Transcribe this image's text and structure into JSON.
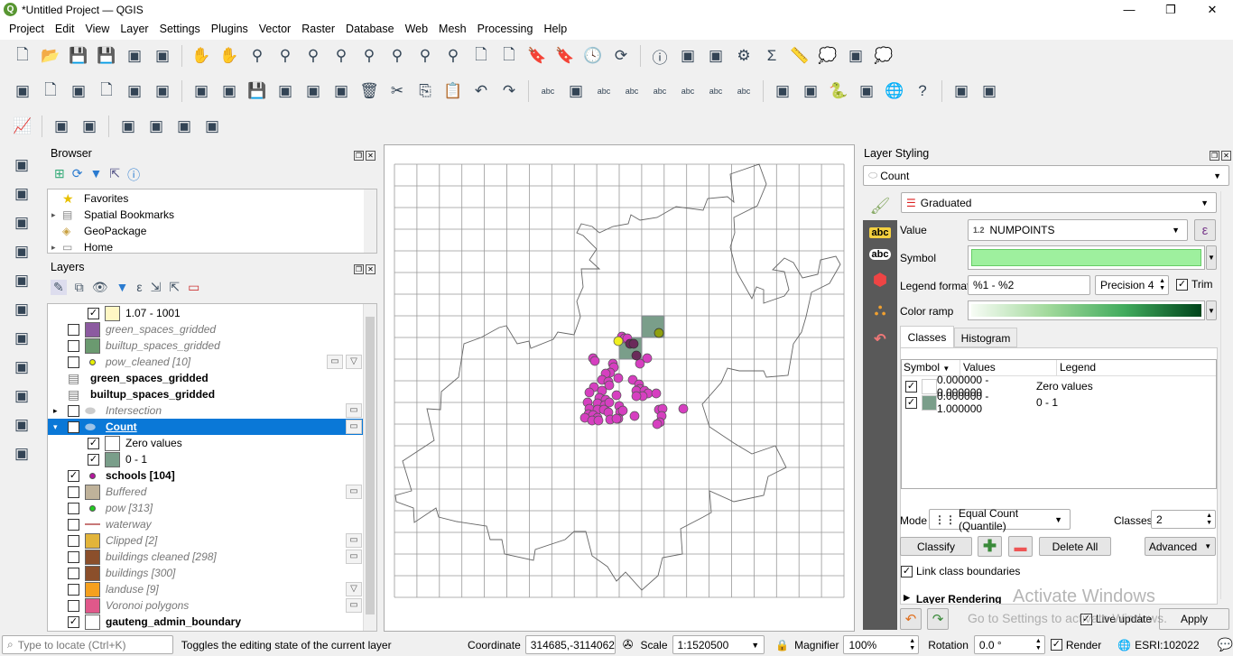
{
  "window": {
    "title": "*Untitled Project — QGIS",
    "minimize": "—",
    "maximize": "❐",
    "close": "✕"
  },
  "menu": [
    "Project",
    "Edit",
    "View",
    "Layer",
    "Settings",
    "Plugins",
    "Vector",
    "Raster",
    "Database",
    "Web",
    "Mesh",
    "Processing",
    "Help"
  ],
  "toolbar1": [
    "new-project-icon",
    "open-project-icon",
    "save-project-icon",
    "save-as-icon",
    "print-layout-icon",
    "layout-manager-icon",
    "sep",
    "pan-icon",
    "pan-to-selection-icon",
    "zoom-in-icon",
    "zoom-out-icon",
    "zoom-full-icon",
    "zoom-to-selection-icon",
    "zoom-to-layer-icon",
    "zoom-native-icon",
    "zoom-last-icon",
    "zoom-next-icon",
    "new-map-view-icon",
    "new-3d-view-icon",
    "bookmark-icon",
    "show-bookmarks-icon",
    "temporal-icon",
    "refresh-icon",
    "sep",
    "identify-icon",
    "attribute-table-icon",
    "field-calculator-icon",
    "toolbox-icon",
    "statistics-icon",
    "measure-icon",
    "annotation-icon",
    "select-by-location-icon",
    "text-annotation-icon"
  ],
  "toolbar2": [
    "data-source-manager-icon",
    "new-geopackage-icon",
    "digitize-icon",
    "new-layer-icon",
    "virtual-layer-icon",
    "georef-icon",
    "sep",
    "edits-icon",
    "toggle-editing-icon",
    "save-edits-icon",
    "add-feature-icon",
    "vertex-tool-icon",
    "modify-attributes-icon",
    "delete-icon",
    "cut-icon",
    "copy-icon",
    "paste-icon",
    "undo-icon",
    "redo-icon",
    "sep",
    "label-icon",
    "diagram-icon",
    "pin-label-icon",
    "highlight-label-icon",
    "move-label-icon",
    "rotate-label-icon",
    "change-label-icon",
    "show-hide-label-icon",
    "sep",
    "metasearch-icon",
    "wms-icon",
    "python-icon",
    "raster-calc-icon",
    "globe-icon",
    "help-icon",
    "sep",
    "geometry-checker-icon",
    "reload-icon"
  ],
  "toolbar3": [
    "profile-icon",
    "sep",
    "locate-icon",
    "digitizing-icon",
    "sep",
    "select-features-icon",
    "select-by-value-icon",
    "deselect-icon",
    "select-location-icon"
  ],
  "lefttoolbar": [
    "add-vector-icon",
    "add-raster-icon",
    "add-mesh-icon",
    "add-delimited-icon",
    "add-spatialite-icon",
    "add-virtual-icon",
    "add-postgis-icon",
    "add-wms-icon",
    "add-wfs-icon",
    "add-wcs-icon",
    "add-arcgis-icon"
  ],
  "browser": {
    "title": "Browser",
    "items": [
      "Favorites",
      "Spatial Bookmarks",
      "GeoPackage",
      "Home"
    ]
  },
  "layers": {
    "title": "Layers",
    "items": [
      {
        "label": "1.07 - 1001",
        "indent": 1,
        "checked": true,
        "sym": "box",
        "color": "#fff7c4",
        "style": "normal"
      },
      {
        "label": "green_spaces_gridded",
        "indent": 0,
        "checked": false,
        "sym": "box",
        "color": "#8c5aa0",
        "style": "gray"
      },
      {
        "label": "builtup_spaces_gridded",
        "indent": 0,
        "checked": false,
        "sym": "box",
        "color": "#6b9a70",
        "style": "gray"
      },
      {
        "label": "pow_cleaned [10]",
        "indent": 0,
        "checked": false,
        "sym": "dot",
        "color": "#e8f000",
        "style": "gray",
        "icons": [
          "memory",
          "filter"
        ]
      },
      {
        "label": "green_spaces_gridded",
        "indent": 0,
        "checked": null,
        "sym": "table",
        "style": "bold"
      },
      {
        "label": "builtup_spaces_gridded",
        "indent": 0,
        "checked": null,
        "sym": "table",
        "style": "bold"
      },
      {
        "label": "Intersection",
        "indent": 0,
        "checked": false,
        "sym": "poly",
        "color": "#ccc",
        "style": "gray",
        "expander": "▸",
        "icons": [
          "memory"
        ]
      },
      {
        "label": "Count",
        "indent": 0,
        "checked": true,
        "sym": "poly",
        "color": "#9cc3e8",
        "style": "selected",
        "expander": "▾",
        "icons": [
          "memory"
        ]
      },
      {
        "label": "Zero values",
        "indent": 1,
        "checked": true,
        "sym": "box",
        "color": "#ffffff",
        "style": "normal"
      },
      {
        "label": "0 - 1",
        "indent": 1,
        "checked": true,
        "sym": "box",
        "color": "#7a9e8a",
        "style": "normal"
      },
      {
        "label": "schools [104]",
        "indent": 0,
        "checked": true,
        "sym": "dot",
        "color": "#b5179e",
        "style": "bold"
      },
      {
        "label": "Buffered",
        "indent": 0,
        "checked": false,
        "sym": "box",
        "color": "#bfb29a",
        "style": "gray",
        "icons": [
          "memory"
        ]
      },
      {
        "label": "pow [313]",
        "indent": 0,
        "checked": false,
        "sym": "dot",
        "color": "#22cc22",
        "style": "gray"
      },
      {
        "label": "waterway",
        "indent": 0,
        "checked": false,
        "sym": "line",
        "color": "#c87878",
        "style": "gray"
      },
      {
        "label": "Clipped [2]",
        "indent": 0,
        "checked": false,
        "sym": "box",
        "color": "#e2b43a",
        "style": "gray",
        "icons": [
          "memory"
        ]
      },
      {
        "label": "buildings cleaned [298]",
        "indent": 0,
        "checked": false,
        "sym": "box",
        "color": "#8b4f2b",
        "style": "gray",
        "icons": [
          "memory"
        ]
      },
      {
        "label": "buildings [300]",
        "indent": 0,
        "checked": false,
        "sym": "box",
        "color": "#8b4f2b",
        "style": "gray"
      },
      {
        "label": "landuse [9]",
        "indent": 0,
        "checked": false,
        "sym": "box",
        "color": "#f5a01e",
        "style": "gray",
        "icons": [
          "filter"
        ]
      },
      {
        "label": "Voronoi polygons",
        "indent": 0,
        "checked": false,
        "sym": "box",
        "color": "#e0588a",
        "style": "gray",
        "icons": [
          "memory"
        ]
      },
      {
        "label": "gauteng_admin_boundary",
        "indent": 0,
        "checked": true,
        "sym": "box",
        "color": "#ffffff",
        "style": "bold"
      }
    ]
  },
  "styling": {
    "title": "Layer Styling",
    "layer": "Count",
    "renderer": "Graduated",
    "value_label": "Value",
    "value_type": "1.2",
    "value": "NUMPOINTS",
    "symbol_label": "Symbol",
    "symbol_color": "#9ef09e",
    "legend_format_label": "Legend format",
    "legend_format": "%1 - %2",
    "precision": "Precision 4",
    "trim": "Trim",
    "color_ramp_label": "Color ramp",
    "ramp": [
      "#f7fcf5",
      "#a1d99b",
      "#41ab5d",
      "#00441b"
    ],
    "tabs": [
      "Classes",
      "Histogram"
    ],
    "columns": [
      "Symbol",
      "Values",
      "Legend"
    ],
    "classes": [
      {
        "values": "0.000000 - 0.000000",
        "legend": "Zero values",
        "color": "#ffffff"
      },
      {
        "values": "0.000000 - 1.000000",
        "legend": "0 - 1",
        "color": "#7a9e8a"
      }
    ],
    "mode_label": "Mode",
    "mode": "Equal Count (Quantile)",
    "classes_label": "Classes",
    "classes_count": "2",
    "classify": "Classify",
    "delete_all": "Delete All",
    "advanced": "Advanced",
    "link": "Link class boundaries",
    "layer_rendering": "Layer Rendering",
    "live_update": "Live update",
    "apply": "Apply",
    "watermark1": "Activate Windows",
    "watermark2": "Go to Settings to activate Windows."
  },
  "status": {
    "locate_placeholder": "Type to locate (Ctrl+K)",
    "message": "Toggles the editing state of the current layer",
    "coordinate_label": "Coordinate",
    "coordinate": "314685,-3114062",
    "scale_label": "Scale",
    "scale": "1:1520500",
    "magnifier_label": "Magnifier",
    "magnifier": "100%",
    "rotation_label": "Rotation",
    "rotation": "0.0 °",
    "render": "Render",
    "crs": "ESRI:102022"
  },
  "map": {
    "grid_cols": 20,
    "grid_rows": 20,
    "filled_cells": [
      [
        11,
        7
      ],
      [
        10,
        8
      ]
    ],
    "fill_color": "#7a9e8a",
    "school_color": "#d63fc0"
  }
}
